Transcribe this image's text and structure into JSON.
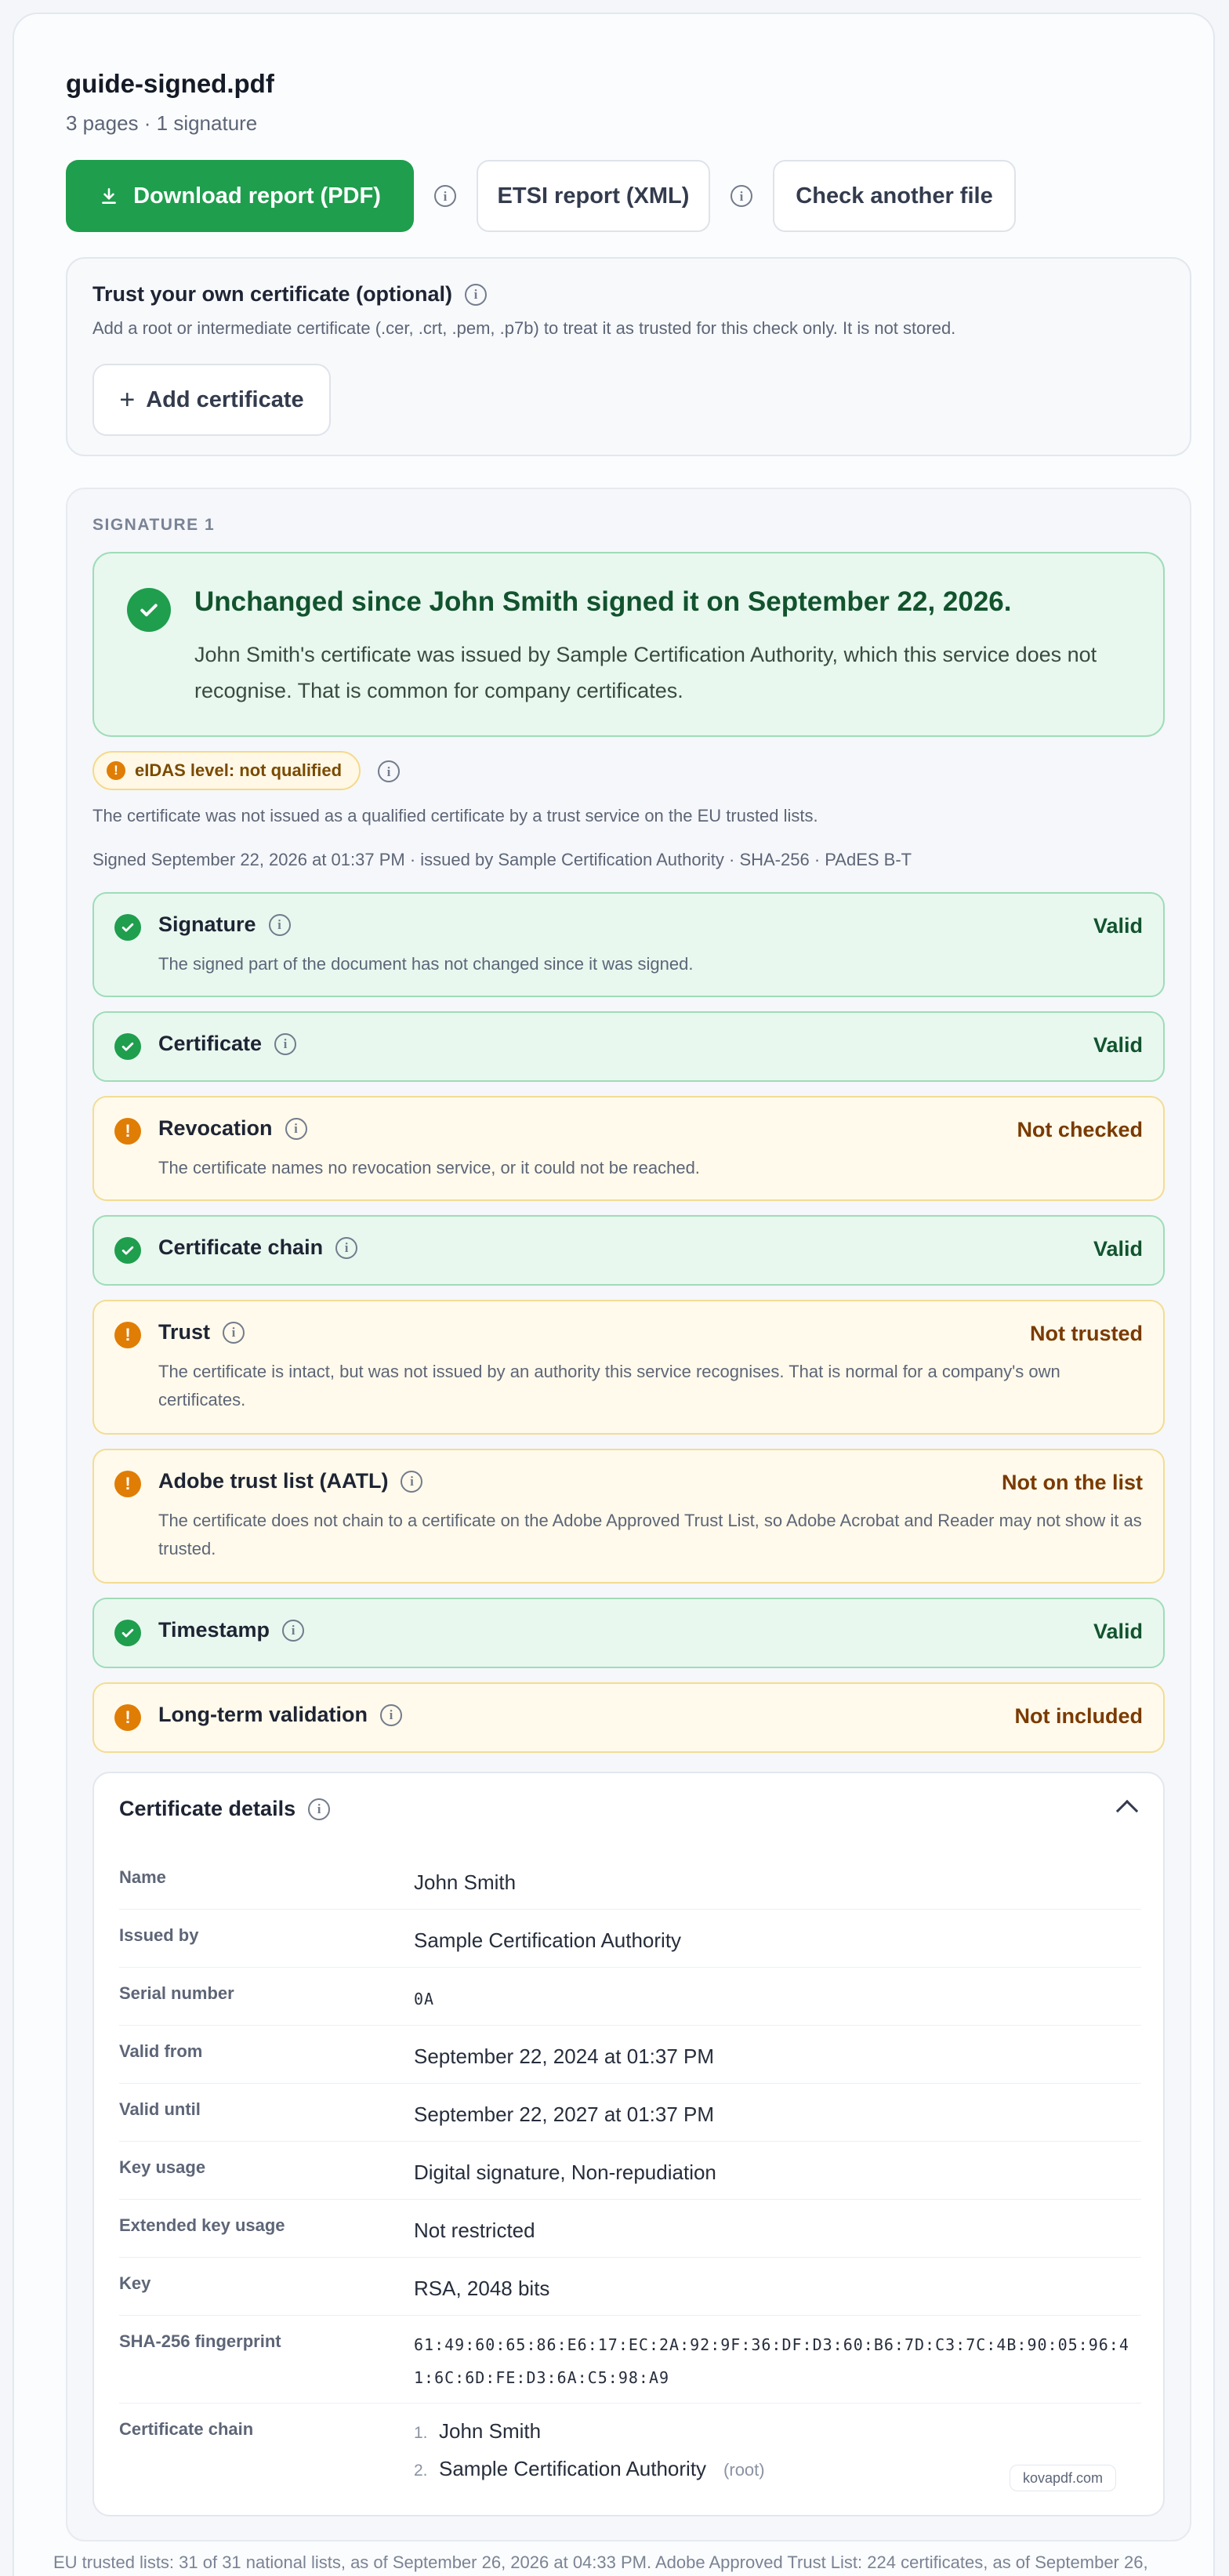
{
  "file": {
    "name": "guide-signed.pdf",
    "meta": "3 pages · 1 signature"
  },
  "actions": {
    "download_pdf": "Download report (PDF)",
    "etsi_xml": "ETSI report (XML)",
    "check_another": "Check another file"
  },
  "trust": {
    "title": "Trust your own certificate (optional)",
    "description": "Add a root or intermediate certificate (.cer, .crt, .pem, .p7b) to treat it as trusted for this check only. It is not stored.",
    "add_button": "Add certificate"
  },
  "signature": {
    "label": "SIGNATURE 1",
    "hero_title": "Unchanged since John Smith signed it on September 22, 2026.",
    "hero_text": "John Smith's certificate was issued by Sample Certification Authority, which this service does not recognise. That is common for company certificates.",
    "eidas_badge": "eIDAS level: not qualified",
    "eidas_desc": "The certificate was not issued as a qualified certificate by a trust service on the EU trusted lists.",
    "signed_meta": "Signed September 22, 2026 at 01:37 PM · issued by Sample Certification Authority · SHA-256 · PAdES B-T",
    "checks": [
      {
        "title": "Signature",
        "status": "Valid",
        "state": "ok",
        "desc": "The signed part of the document has not changed since it was signed."
      },
      {
        "title": "Certificate",
        "status": "Valid",
        "state": "ok",
        "desc": ""
      },
      {
        "title": "Revocation",
        "status": "Not checked",
        "state": "warn",
        "desc": "The certificate names no revocation service, or it could not be reached."
      },
      {
        "title": "Certificate chain",
        "status": "Valid",
        "state": "ok",
        "desc": ""
      },
      {
        "title": "Trust",
        "status": "Not trusted",
        "state": "warn",
        "desc": "The certificate is intact, but was not issued by an authority this service recognises. That is normal for a company's own certificates."
      },
      {
        "title": "Adobe trust list (AATL)",
        "status": "Not on the list",
        "state": "warn",
        "desc": "The certificate does not chain to a certificate on the Adobe Approved Trust List, so Adobe Acrobat and Reader may not show it as trusted."
      },
      {
        "title": "Timestamp",
        "status": "Valid",
        "state": "ok",
        "desc": ""
      },
      {
        "title": "Long-term validation",
        "status": "Not included",
        "state": "warn",
        "desc": ""
      }
    ]
  },
  "cert": {
    "title": "Certificate details",
    "rows": [
      {
        "label": "Name",
        "value": "John Smith"
      },
      {
        "label": "Issued by",
        "value": "Sample Certification Authority"
      },
      {
        "label": "Serial number",
        "value": "0A"
      },
      {
        "label": "Valid from",
        "value": "September 22, 2024 at 01:37 PM"
      },
      {
        "label": "Valid until",
        "value": "September 22, 2027 at 01:37 PM"
      },
      {
        "label": "Key usage",
        "value": "Digital signature, Non-repudiation"
      },
      {
        "label": "Extended key usage",
        "value": "Not restricted"
      },
      {
        "label": "Key",
        "value": "RSA, 2048 bits"
      },
      {
        "label": "SHA-256 fingerprint",
        "value": "61:49:60:65:86:E6:17:EC:2A:92:9F:36:DF:D3:60:B6:7D:C3:7C:4B:90:05:96:41:6C:6D:FE:D3:6A:C5:98:A9"
      },
      {
        "label": "Certificate chain",
        "value": ""
      }
    ],
    "chain": [
      {
        "num": "1.",
        "name": "John Smith",
        "tag": ""
      },
      {
        "num": "2.",
        "name": "Sample Certification Authority",
        "tag": "(root)"
      }
    ],
    "watermark": "kovapdf.com"
  },
  "footer": "EU trusted lists: 31 of 31 national lists, as of September 26, 2026 at 04:33 PM. Adobe Approved Trust List: 224 certificates, as of September 26,"
}
